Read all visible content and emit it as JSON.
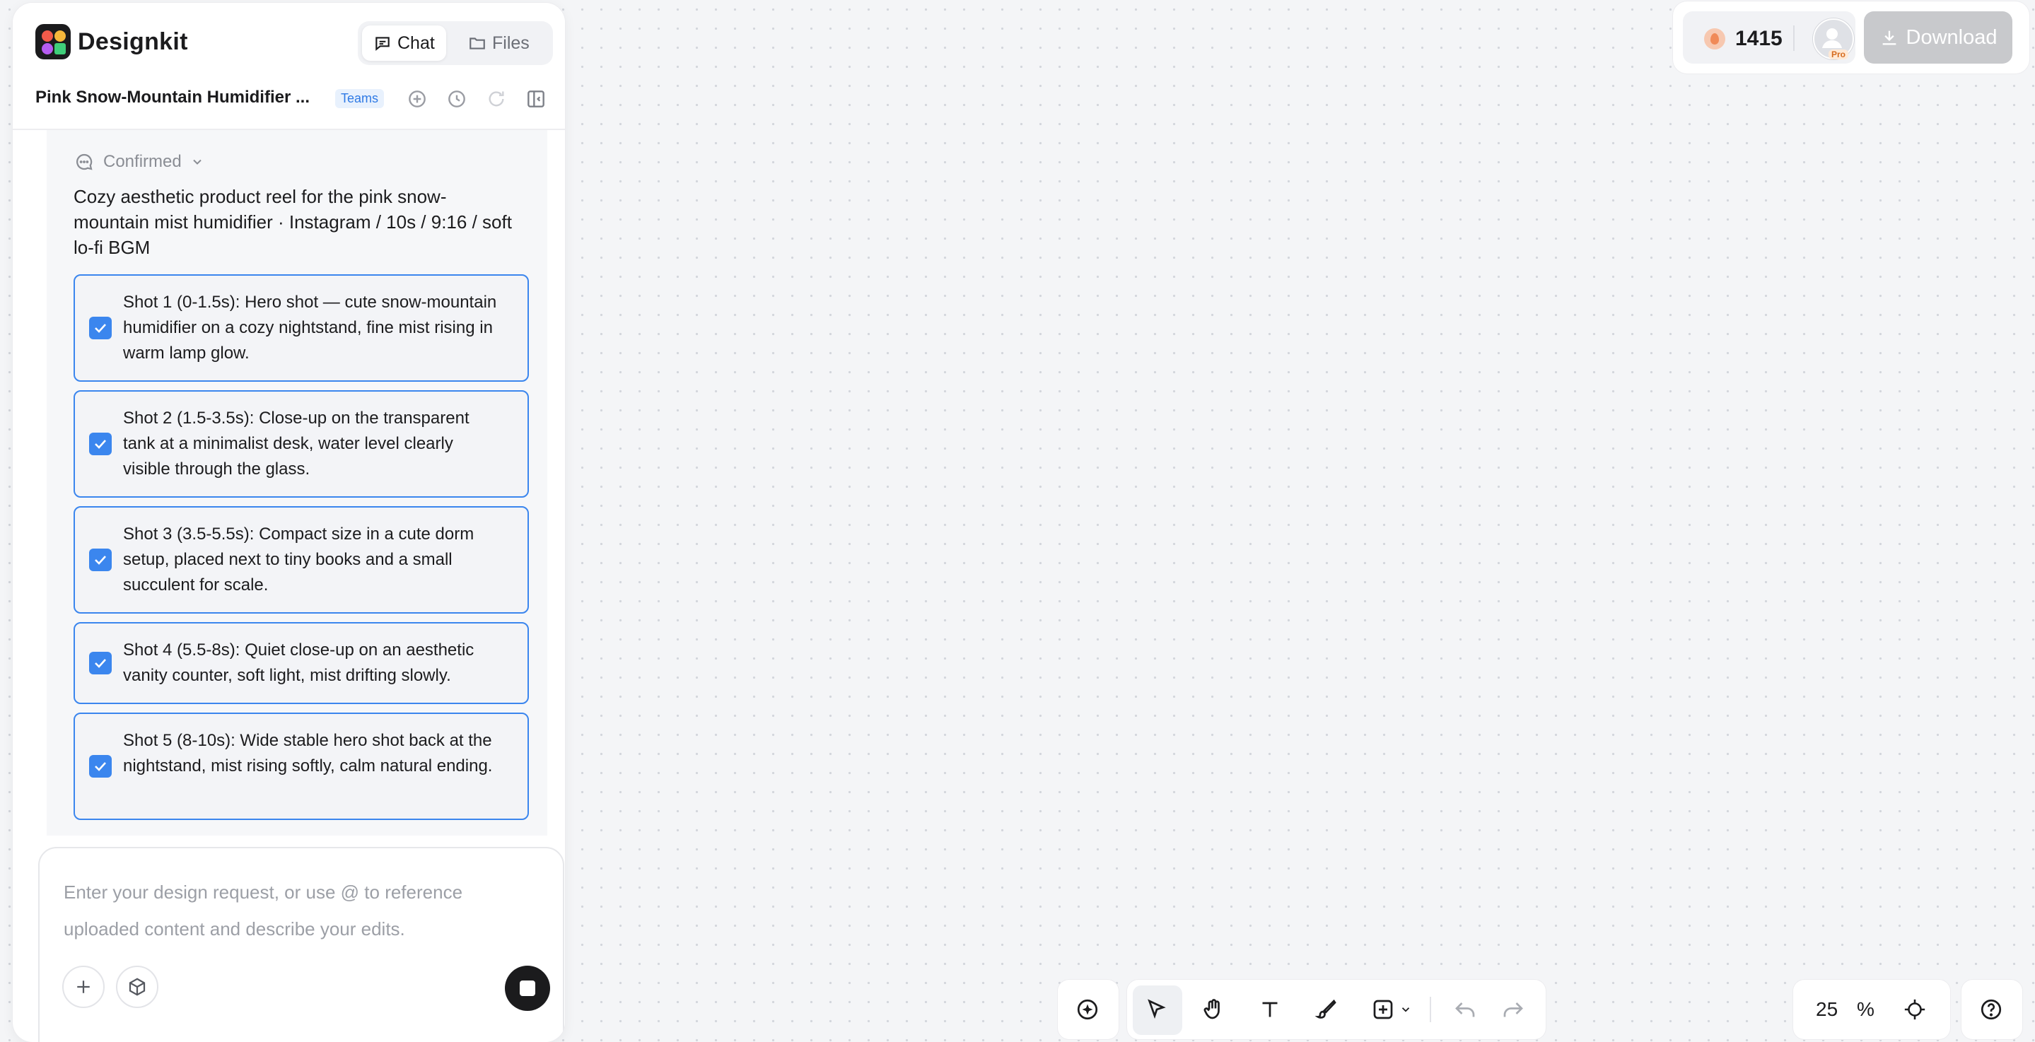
{
  "app": {
    "name": "Designkit"
  },
  "header": {
    "tabs": [
      {
        "label": "Chat",
        "active": true
      },
      {
        "label": "Files",
        "active": false
      }
    ],
    "project_title": "Pink Snow-Mountain Humidifier ...",
    "badge": "Teams",
    "icons": [
      "add-circle-icon",
      "history-icon",
      "refresh-icon",
      "collapse-panel-icon"
    ]
  },
  "chat": {
    "status_label": "Confirmed",
    "summary": "Cozy aesthetic product reel for the pink snow-mountain mist humidifier · Instagram / 10s / 9:16 / soft lo-fi BGM",
    "shots": [
      {
        "text": "Shot 1 (0-1.5s): Hero shot — cute snow-mountain humidifier on a cozy nightstand, fine mist rising in warm lamp glow.",
        "checked": true
      },
      {
        "text": "Shot 2 (1.5-3.5s): Close-up on the transparent tank at a minimalist desk, water level clearly visible through the glass.",
        "checked": true
      },
      {
        "text": "Shot 3 (3.5-5.5s): Compact size in a cute dorm setup, placed next to tiny books and a small succulent for scale.",
        "checked": true
      },
      {
        "text": "Shot 4 (5.5-8s): Quiet close-up on an aesthetic vanity counter, soft light, mist drifting slowly.",
        "checked": true
      },
      {
        "text": "Shot 5 (8-10s): Wide stable hero shot back at the nightstand, mist rising softly, calm natural ending.",
        "checked": true
      }
    ]
  },
  "input": {
    "placeholder": "Enter your design request, or use @ to reference uploaded content and describe your edits."
  },
  "topbar": {
    "credits": "1415",
    "avatar_badge": "Pro",
    "download_label": "Download"
  },
  "toolbar": {
    "tools": [
      "ai-sparkle-icon",
      "select-cursor-icon",
      "hand-icon",
      "text-icon",
      "brush-icon",
      "add-frame-icon",
      "undo-icon",
      "redo-icon"
    ],
    "zoom_value": "25",
    "zoom_unit": "%"
  },
  "colors": {
    "accent": "#3b86ee",
    "panel_bg": "#ffffff",
    "canvas_bg": "#f4f5f7"
  }
}
